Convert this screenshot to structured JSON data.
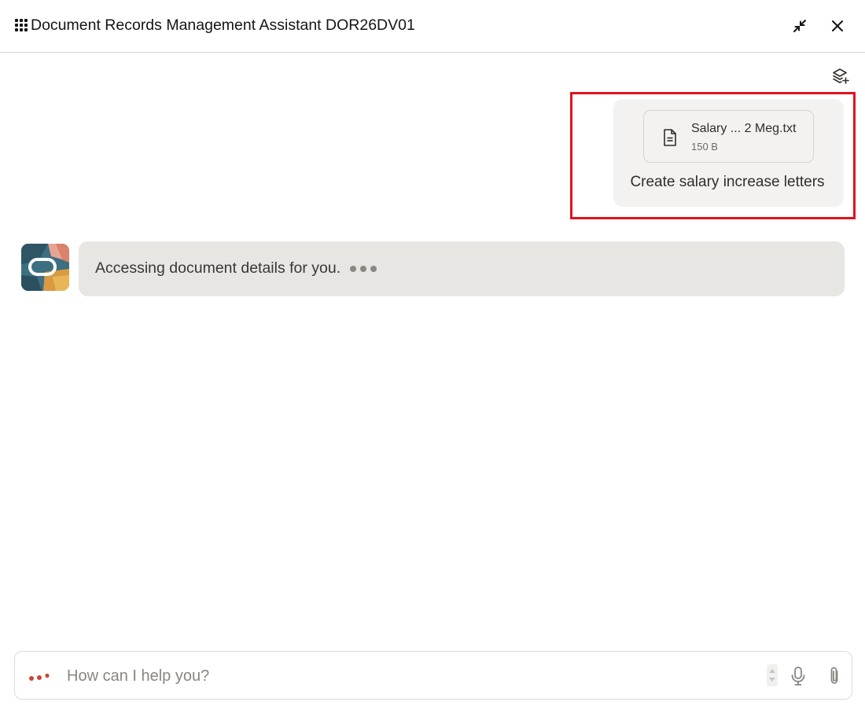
{
  "header": {
    "title": "Document Records Management Assistant DOR26DV01"
  },
  "conversation": {
    "user_message": {
      "attachment": {
        "name": "Salary ... 2 Meg.txt",
        "size": "150 B"
      },
      "text": "Create salary increase letters"
    },
    "assistant_message": {
      "text": "Accessing document details for you."
    }
  },
  "input": {
    "placeholder": "How can I help you?",
    "value": ""
  },
  "colors": {
    "highlight": "#e0141d",
    "user_bubble": "#f3f2f0",
    "bot_bubble": "#e7e6e3",
    "accent_dots": "#c74634"
  },
  "icons": {
    "header_left": "grip-icon",
    "minimize": "minimize-icon",
    "close": "close-icon",
    "new_chat": "layers-plus-icon",
    "file": "document-icon",
    "mic": "microphone-icon",
    "attach": "paperclip-icon"
  }
}
